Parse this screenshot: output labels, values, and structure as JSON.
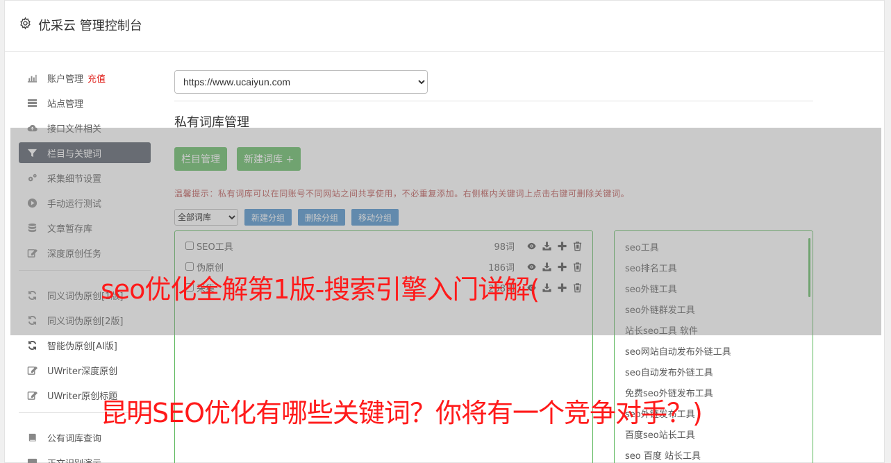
{
  "app": {
    "title": "优采云 管理控制台"
  },
  "sidebar": {
    "group1": [
      {
        "label": "账户管理",
        "badge": "充值",
        "icon": "bar-chart-icon"
      },
      {
        "label": "站点管理",
        "icon": "server-icon"
      },
      {
        "label": "接口文件相关",
        "icon": "cloud-upload-icon"
      },
      {
        "label": "栏目与关键词",
        "icon": "filter-icon",
        "active": true
      },
      {
        "label": "采集细节设置",
        "icon": "gears-icon"
      },
      {
        "label": "手动运行测试",
        "icon": "play-circle-icon"
      },
      {
        "label": "文章暂存库",
        "icon": "database-icon"
      },
      {
        "label": "深度原创任务",
        "icon": "edit-icon"
      }
    ],
    "group2": [
      {
        "label": "同义词伪原创[1版]",
        "icon": "refresh-icon"
      },
      {
        "label": "同义词伪原创[2版]",
        "icon": "refresh-icon"
      },
      {
        "label": "智能伪原创[AI版]",
        "icon": "refresh-icon"
      },
      {
        "label": "UWriter深度原创",
        "icon": "edit-icon"
      },
      {
        "label": "UWriter原创标题",
        "icon": "edit-icon"
      }
    ],
    "group3": [
      {
        "label": "公有词库查询",
        "icon": "book-icon"
      },
      {
        "label": "正文识别演示",
        "icon": "desktop-icon"
      }
    ]
  },
  "main": {
    "site_select": {
      "value": "https://www.ucaiyun.com"
    },
    "section_title": "私有词库管理",
    "buttons": {
      "column_mgmt": "栏目管理",
      "new_library": "新建词库 +"
    },
    "tip": "温馨提示：私有词库可以在同账号不同网站之间共享使用，不必重复添加。右侧框内关键词上点击右键可删除关键词。",
    "filter": {
      "group_select": "全部词库",
      "new_group": "新建分组",
      "delete_group": "删除分组",
      "move_group": "移动分组"
    },
    "libraries": [
      {
        "name": "SEO工具",
        "count": "98词"
      },
      {
        "name": "伪原创",
        "count": "186词"
      },
      {
        "name": "采集",
        "count": "258词"
      }
    ],
    "keywords": [
      "seo工具",
      "seo排名工具",
      "seo外链工具",
      "seo外链群发工具",
      "站长seo工具 软件",
      "seo网站自动发布外链工具",
      "seo自动发布外链工具",
      "免费seo外链发布工具",
      "seo外链发布工具",
      "百度seo站长工具",
      "seo 百度 站长工具"
    ]
  },
  "overlay": {
    "headline1": "seo优化全解第1版-搜索引擎入门详解(",
    "headline2": "昆明SEO优化有哪些关键词？你将有一个竞争对手？)"
  },
  "colors": {
    "accent_green": "#5cb85c",
    "accent_blue": "#428bca",
    "active_nav": "#4e5561",
    "headline_red": "#ff1a1a"
  }
}
